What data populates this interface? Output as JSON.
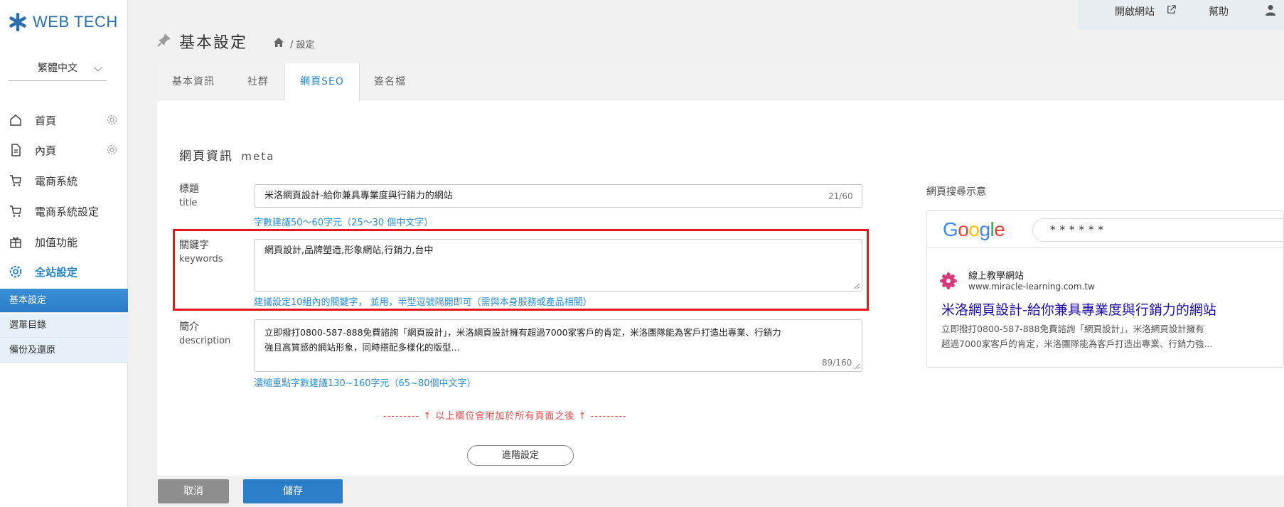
{
  "brand": {
    "name": "WEB TECH",
    "accent": "#2a6fb0"
  },
  "sidebar": {
    "language": "繁體中文",
    "items": [
      {
        "label": "首頁",
        "icon": "home-outline-icon",
        "has_settings": true
      },
      {
        "label": "內頁",
        "icon": "document-icon",
        "has_settings": true
      },
      {
        "label": "電商系統",
        "icon": "cart-icon"
      },
      {
        "label": "電商系統設定",
        "icon": "cart-icon"
      },
      {
        "label": "加值功能",
        "icon": "gift-icon"
      },
      {
        "label": "全站設定",
        "icon": "gear-icon",
        "active": true
      }
    ],
    "subitems": [
      {
        "label": "基本設定",
        "selected": true
      },
      {
        "label": "選單目錄"
      },
      {
        "label": "備份及還原"
      }
    ]
  },
  "topbar": {
    "open_site": "開啟網站",
    "help": "幫助"
  },
  "header": {
    "title": "基本設定",
    "breadcrumb": "/ 設定"
  },
  "tabs": [
    {
      "label": "基本資訊"
    },
    {
      "label": "社群"
    },
    {
      "label": "網頁SEO",
      "active": true
    },
    {
      "label": "簽名檔"
    }
  ],
  "section": {
    "title": "網頁資訊",
    "title_en": "meta"
  },
  "fields": {
    "title": {
      "label": "標題",
      "label_en": "title",
      "value": "米洛網頁設計-給你兼具專業度與行銷力的網站",
      "counter": "21/60",
      "hint": "字數建議50～60字元（25～30 個中文字）"
    },
    "keywords": {
      "label": "關鍵字",
      "label_en": "keywords",
      "value": "網頁設計,品牌塑造,形象網站,行銷力,台中",
      "hint": "建議設定10組內的關鍵字， 並用，半型逗號隔開即可（需與本身服務或產品相關）"
    },
    "description": {
      "label": "簡介",
      "label_en": "description",
      "line1": "立即撥打0800-587-888免費諮詢「網頁設計」，米洛網頁設計擁有超過7000家客戶的肯定，米洛團隊能為客戶打造出專業、行銷力",
      "line2": "強且高質感的網站形象，同時搭配多樣化的版型...",
      "counter": "89/160",
      "hint": "濃縮重點字數建議130~160字元（65~80個中文字）"
    }
  },
  "notice": "--------- ↑ 以上欄位會附加於所有頁面之後 ↑ ---------",
  "advanced_button": "進階設定",
  "preview": {
    "label": "網頁搜尋示意",
    "logo_letters": [
      "G",
      "o",
      "o",
      "g",
      "l",
      "e"
    ],
    "search_text": "******",
    "site_name": "線上教學網站",
    "site_url": "www.miracle-learning.com.tw",
    "result_title": "米洛網頁設計-給你兼具專業度與行銷力的網站",
    "desc_line1": "立即撥打0800-587-888免費諮詢「網頁設計」，米洛網頁設計擁有",
    "desc_line2": "超過7000家客戶的肯定，米洛團隊能為客戶打造出專業、行銷力強..."
  },
  "buttons": {
    "cancel": "取消",
    "save": "儲存"
  },
  "colors": {
    "link_blue": "#2a90d6",
    "highlight_red": "#e8131b",
    "save_blue": "#2b7ec7"
  }
}
